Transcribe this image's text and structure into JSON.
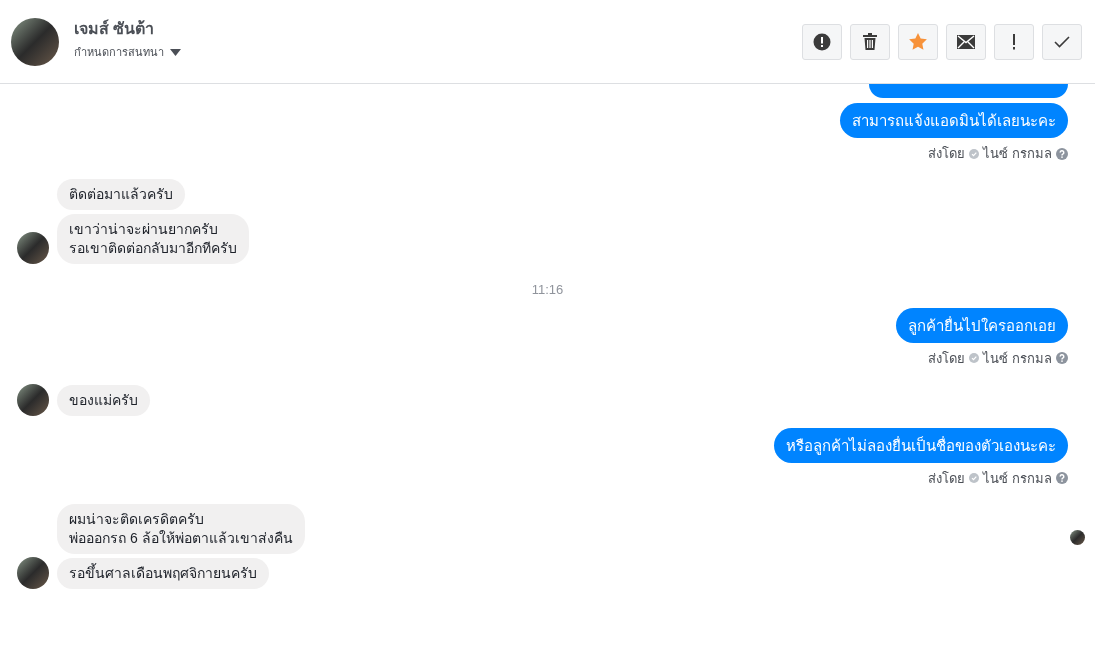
{
  "header": {
    "name": "เจมส์ ซันต้า",
    "subtitle": "กำหนดการสนทนา"
  },
  "toolbar": [
    {
      "kind": "alert"
    },
    {
      "kind": "trash"
    },
    {
      "kind": "star",
      "on": true
    },
    {
      "kind": "mail"
    },
    {
      "kind": "exclaim"
    },
    {
      "kind": "check"
    }
  ],
  "messages": [
    {
      "kind": "outgoing",
      "clipped_top": true,
      "bubbles": [
        "สามารถแจ้งแอดมินได้เลยนะคะ"
      ],
      "sent_by_label": "ส่งโดย",
      "sender": "ไนซ์ กรกมล"
    },
    {
      "kind": "incoming",
      "bubbles": [
        "ติดต่อมาแล้วครับ",
        "เขาว่าน่าจะผ่านยากครับ\nรอเขาติดต่อกลับมาอีกทีครับ"
      ]
    },
    {
      "kind": "time",
      "text": "11:16"
    },
    {
      "kind": "outgoing",
      "bubbles": [
        "ลูกค้ายื่นไปใครออกเอย"
      ],
      "sent_by_label": "ส่งโดย",
      "sender": "ไนซ์ กรกมล"
    },
    {
      "kind": "incoming",
      "bubbles": [
        "ของแม่ครับ"
      ]
    },
    {
      "kind": "outgoing",
      "bubbles": [
        "หรือลูกค้าไม่ลองยื่นเป็นชื่อของตัวเองนะคะ"
      ],
      "sent_by_label": "ส่งโดย",
      "sender": "ไนซ์ กรกมล"
    },
    {
      "kind": "incoming",
      "bubbles": [
        "ผมน่าจะติดเครดิตครับ\nพ่อออกรถ 6 ล้อให้พ่อตาแล้วเขาส่งคืน",
        "รอขึ้นศาลเดือนพฤศจิกายนครับ"
      ],
      "read_receipt": true
    }
  ]
}
